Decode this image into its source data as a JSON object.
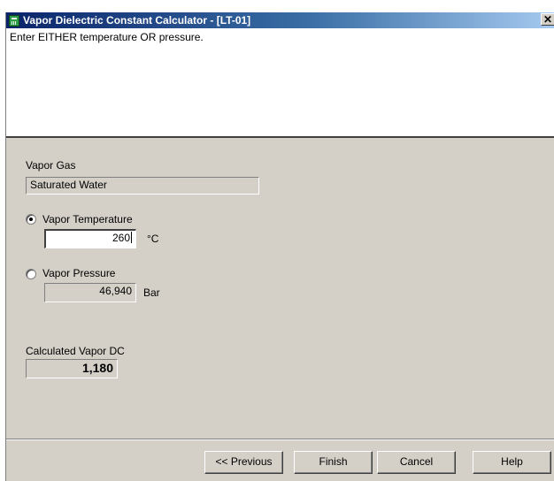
{
  "window": {
    "title": "Vapor Dielectric Constant Calculator - [LT-01]",
    "close_glyph": "✕",
    "icon": "calculator-icon"
  },
  "instructions": "Enter EITHER temperature OR pressure.",
  "vapor_gas": {
    "label": "Vapor Gas",
    "value": "Saturated Water"
  },
  "temperature": {
    "label": "Vapor Temperature",
    "value": "260",
    "unit": "°C",
    "selected": true
  },
  "pressure": {
    "label": "Vapor Pressure",
    "value": "46,940",
    "unit": "Bar",
    "selected": false
  },
  "result": {
    "label": "Calculated Vapor DC",
    "value": "1,180"
  },
  "buttons": {
    "previous": "<< Previous",
    "finish": "Finish",
    "cancel": "Cancel",
    "help": "Help"
  },
  "colors": {
    "titlebar_start": "#0a246a",
    "titlebar_end": "#a6caf0",
    "dialog_bg": "#d4d0c8"
  }
}
